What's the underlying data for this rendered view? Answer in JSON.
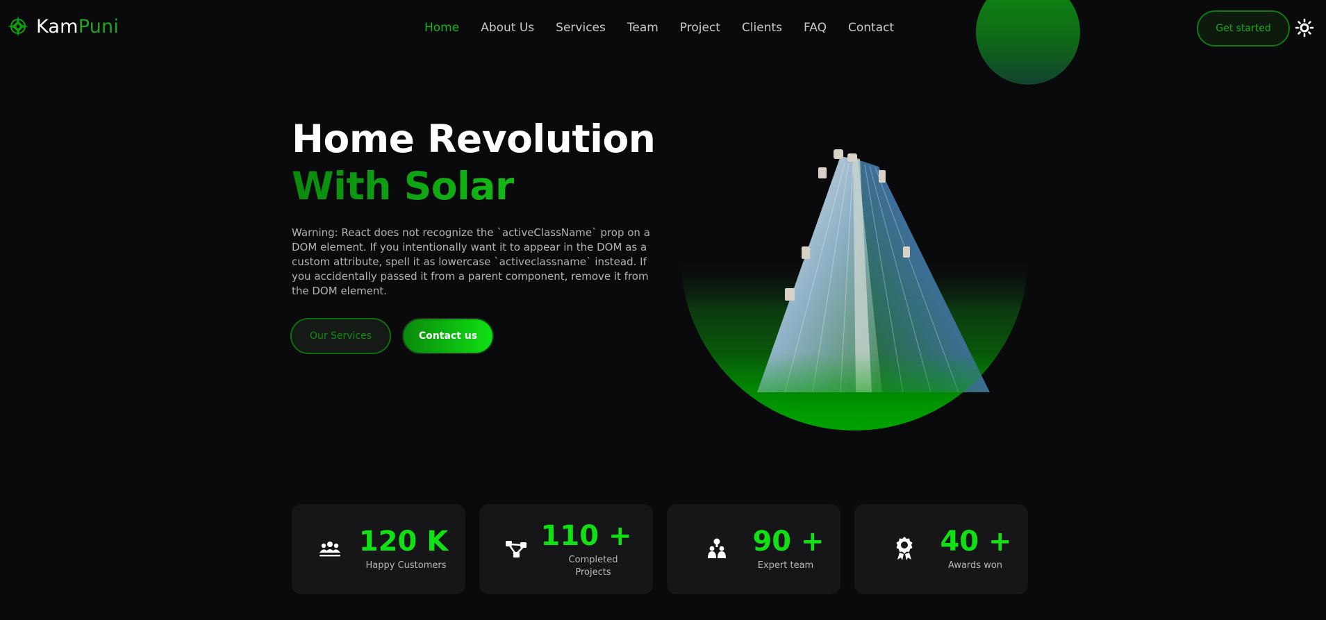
{
  "brand": {
    "name_part1": "Kam",
    "name_part2": "Puni",
    "accent": "#16b516"
  },
  "nav": {
    "items": [
      {
        "label": "Home",
        "active": true
      },
      {
        "label": "About Us"
      },
      {
        "label": "Services"
      },
      {
        "label": "Team"
      },
      {
        "label": "Project"
      },
      {
        "label": "Clients"
      },
      {
        "label": "FAQ"
      },
      {
        "label": "Contact"
      }
    ]
  },
  "header": {
    "cta_label": "Get started",
    "theme_icon": "sun-icon"
  },
  "hero": {
    "title_line1": "Home Revolution",
    "title_line2": "With Solar",
    "description": "Warning: React does not recognize the `activeClassName` prop on a DOM element. If you intentionally want it to appear in the DOM as a custom attribute, spell it as lowercase `activeclassname` instead. If you accidentally passed it from a parent component, remove it from the DOM element.",
    "btn_services": "Our Services",
    "btn_contact": "Contact us"
  },
  "stats": [
    {
      "icon": "users-icon",
      "value": "120 K",
      "label": "Happy Customers"
    },
    {
      "icon": "project-nodes-icon",
      "value": "110 +",
      "label": "Completed Projects"
    },
    {
      "icon": "team-icon",
      "value": "90 +",
      "label": "Expert team"
    },
    {
      "icon": "award-icon",
      "value": "40 +",
      "label": "Awards won"
    }
  ]
}
